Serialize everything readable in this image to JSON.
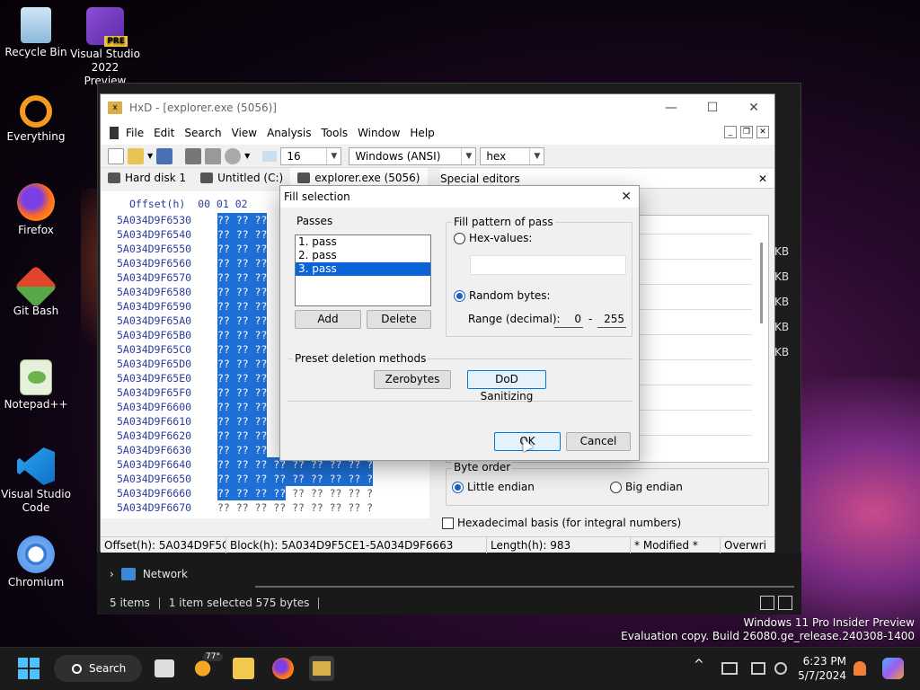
{
  "desktop": {
    "icons": [
      {
        "label": "Recycle Bin"
      },
      {
        "label": "Visual Studio 2022 Preview",
        "line1": "Visual Studio",
        "line2": "2022 Preview",
        "badge": "PRE"
      },
      {
        "label": "Everything"
      },
      {
        "label": "Firefox"
      },
      {
        "label": "Git Bash"
      },
      {
        "label": "Notepad++"
      },
      {
        "label": "Visual Studio Code",
        "line1": "Visual Studio",
        "line2": "Code"
      },
      {
        "label": "Chromium"
      }
    ]
  },
  "explorer": {
    "nav_item": "Network",
    "status_items": "5 items",
    "status_selected": "1 item selected  575 bytes",
    "right_sizes": [
      "KB",
      "KB",
      "KB",
      "KB",
      "KB"
    ]
  },
  "hxd": {
    "title": "HxD - [explorer.exe (5056)]",
    "menu": [
      "File",
      "Edit",
      "Search",
      "View",
      "Analysis",
      "Tools",
      "Window",
      "Help"
    ],
    "toolbar": {
      "columns": "16",
      "encoding": "Windows (ANSI)",
      "base": "hex"
    },
    "tabs": [
      "Hard disk 1",
      "Untitled (C:)",
      "explorer.exe (5056)"
    ],
    "special_editors": "Special editors",
    "hex_header": "Offset(h)  00 01 02",
    "hex_rows": [
      {
        "offset": "5A034D9F6530",
        "bytes": "?? ?? ??",
        "tail": ""
      },
      {
        "offset": "5A034D9F6540",
        "bytes": "?? ?? ??",
        "tail": ""
      },
      {
        "offset": "5A034D9F6550",
        "bytes": "?? ?? ??",
        "tail": ""
      },
      {
        "offset": "5A034D9F6560",
        "bytes": "?? ?? ??",
        "tail": ""
      },
      {
        "offset": "5A034D9F6570",
        "bytes": "?? ?? ??",
        "tail": ""
      },
      {
        "offset": "5A034D9F6580",
        "bytes": "?? ?? ??",
        "tail": ""
      },
      {
        "offset": "5A034D9F6590",
        "bytes": "?? ?? ??",
        "tail": ""
      },
      {
        "offset": "5A034D9F65A0",
        "bytes": "?? ?? ??",
        "tail": ""
      },
      {
        "offset": "5A034D9F65B0",
        "bytes": "?? ?? ??",
        "tail": ""
      },
      {
        "offset": "5A034D9F65C0",
        "bytes": "?? ?? ??",
        "tail": ""
      },
      {
        "offset": "5A034D9F65D0",
        "bytes": "?? ?? ??",
        "tail": ""
      },
      {
        "offset": "5A034D9F65E0",
        "bytes": "?? ?? ??",
        "tail": ""
      },
      {
        "offset": "5A034D9F65F0",
        "bytes": "?? ?? ??",
        "tail": ""
      },
      {
        "offset": "5A034D9F6600",
        "bytes": "?? ?? ??",
        "tail": ""
      },
      {
        "offset": "5A034D9F6610",
        "bytes": "?? ?? ??",
        "tail": ""
      },
      {
        "offset": "5A034D9F6620",
        "bytes": "?? ?? ??",
        "tail": ""
      },
      {
        "offset": "5A034D9F6630",
        "bytes": "?? ?? ??",
        "tail": ""
      },
      {
        "offset": "5A034D9F6640",
        "bytes": "?? ?? ?? ?? ?? ?? ?? ?? ?",
        "tail": ""
      },
      {
        "offset": "5A034D9F6650",
        "bytes": "?? ?? ?? ?? ?? ?? ?? ?? ?",
        "tail": ""
      },
      {
        "offset": "5A034D9F6660",
        "bytes": "?? ?? ?? ??",
        "tail": " ?? ?? ?? ?? ?"
      },
      {
        "offset": "5A034D9F6670",
        "bytes": "",
        "tail": "?? ?? ?? ?? ?? ?? ?? ?? ?"
      }
    ],
    "byte_order": {
      "legend": "Byte order",
      "little": "Little endian",
      "big": "Big endian",
      "selected": "little"
    },
    "hex_basis": "Hexadecimal basis (for integral numbers)",
    "status": {
      "offset": "Offset(h): 5A034D9F5CE1",
      "block": "Block(h): 5A034D9F5CE1-5A034D9F6663",
      "length": "Length(h): 983",
      "modified": "* Modified *",
      "mode": "Overwri"
    }
  },
  "dialog": {
    "title": "Fill selection",
    "passes_legend": "Passes",
    "passes": [
      "1. pass",
      "2. pass",
      "3. pass"
    ],
    "selected_pass": 2,
    "add": "Add",
    "delete": "Delete",
    "fill_legend": "Fill pattern of pass",
    "hex_values": "Hex-values:",
    "random_bytes": "Random bytes:",
    "range_label": "Range (decimal):",
    "range_min": "0",
    "range_sep": "-",
    "range_max": "255",
    "preset_legend": "Preset deletion methods",
    "zerobytes": "Zerobytes",
    "dod": "DoD Sanitizing",
    "ok": "OK",
    "cancel": "Cancel"
  },
  "taskbar": {
    "search": "Search",
    "weather": "77°",
    "time": "6:23 PM",
    "date": "5/7/2024"
  },
  "watermark": {
    "line1": "Windows 11 Pro Insider Preview",
    "line2": "Evaluation copy. Build 26080.ge_release.240308-1400"
  }
}
